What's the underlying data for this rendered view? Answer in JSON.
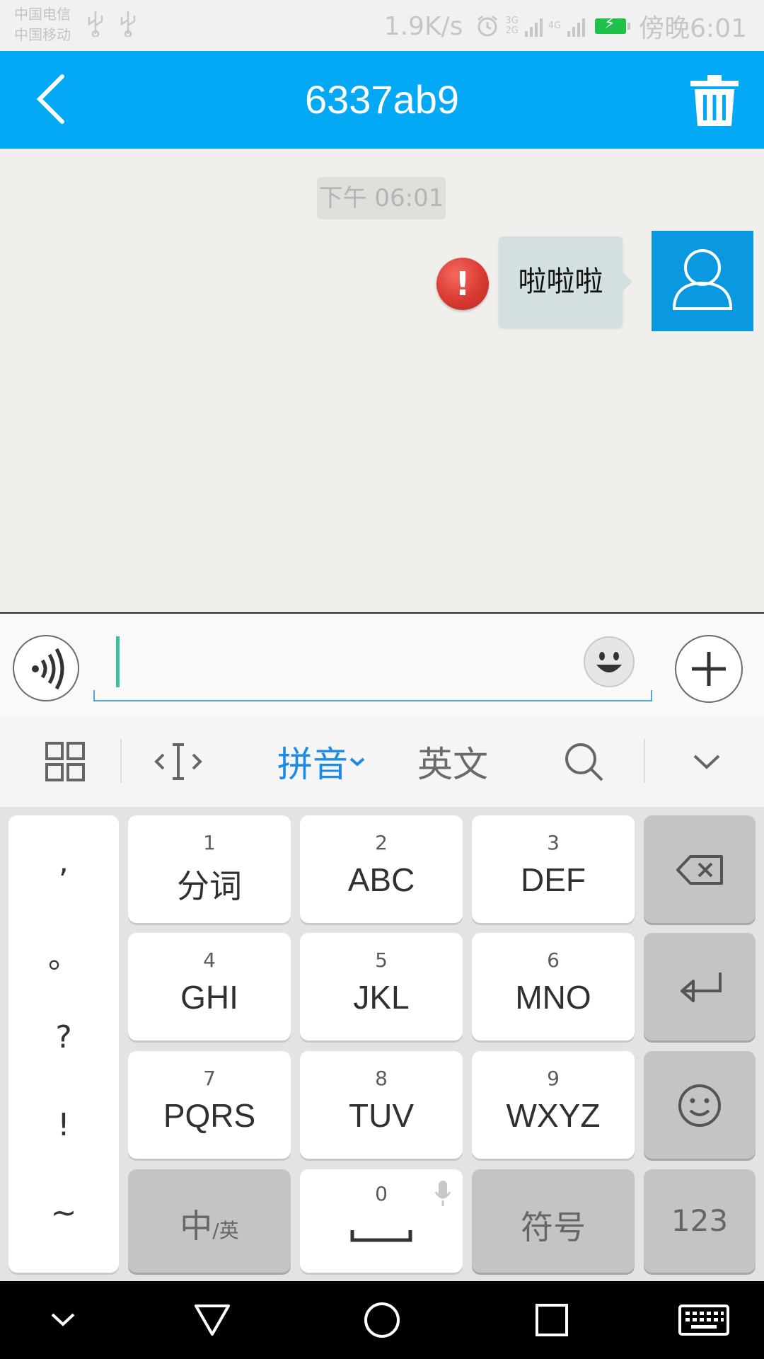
{
  "status_bar": {
    "carrier_1": "中国电信",
    "carrier_2": "中国移动",
    "net_speed": "1.9K/s",
    "net_labels_1": "3G\n2G",
    "net_labels_2": "4G",
    "time": "傍晚6:01",
    "colors": {
      "battery": "#21c04a"
    }
  },
  "header": {
    "title": "6337ab9",
    "icons": {
      "back": "chevron-left-icon",
      "delete": "trash-icon"
    },
    "color": "#03a9f4"
  },
  "chat": {
    "timestamp": "下午 06:01",
    "messages": [
      {
        "text": "啦啦啦",
        "status": "failed",
        "status_icon": "exclamation-icon",
        "avatar_icon": "user-icon"
      }
    ]
  },
  "input_bar": {
    "value": "",
    "icons": {
      "voice": "voice-wave-icon",
      "emoji": "emoji-icon",
      "more": "plus-icon"
    }
  },
  "ime_toolbar": {
    "items": [
      {
        "icon": "grid-icon"
      },
      {
        "icon": "cursor-move-icon"
      },
      {
        "label": "拼音",
        "active": true,
        "icon": "chevron-down-icon"
      },
      {
        "label": "英文",
        "active": false
      },
      {
        "icon": "search-icon"
      },
      {
        "icon": "collapse-keyboard-icon"
      }
    ]
  },
  "keyboard": {
    "punctuation": [
      ",",
      "。",
      "?",
      "!",
      "~"
    ],
    "keys": [
      {
        "num": "1",
        "letters": "分词"
      },
      {
        "num": "2",
        "letters": "ABC"
      },
      {
        "num": "3",
        "letters": "DEF"
      },
      {
        "num": "4",
        "letters": "GHI"
      },
      {
        "num": "5",
        "letters": "JKL"
      },
      {
        "num": "6",
        "letters": "MNO"
      },
      {
        "num": "7",
        "letters": "PQRS"
      },
      {
        "num": "8",
        "letters": "TUV"
      },
      {
        "num": "9",
        "letters": "WXYZ"
      }
    ],
    "zh_en_main": "中",
    "zh_en_sub": "/英",
    "space_num": "0",
    "symbols": "符号",
    "numbers": "123",
    "icons": {
      "backspace": "backspace-icon",
      "enter": "enter-icon",
      "emoji": "smiley-icon",
      "mic": "mic-icon",
      "space": "space-icon"
    }
  },
  "nav_bar": {
    "icons": [
      "hide-icon",
      "back-triangle-icon",
      "home-circle-icon",
      "recents-square-icon",
      "keyboard-icon"
    ]
  }
}
